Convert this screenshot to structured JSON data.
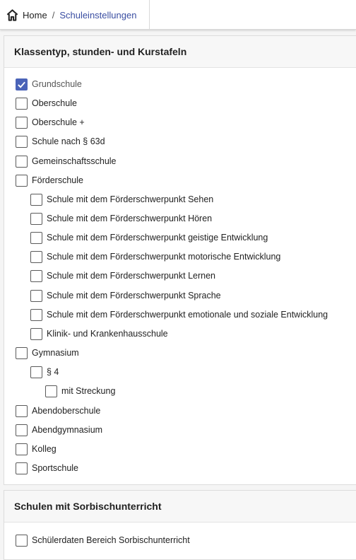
{
  "breadcrumb": {
    "home": "Home",
    "separator": "/",
    "current": "Schuleinstellungen"
  },
  "section1": {
    "title": "Klassentyp, stunden- und Kurstafeln",
    "items": [
      {
        "label": "Grundschule",
        "checked": true
      },
      {
        "label": "Oberschule",
        "checked": false
      },
      {
        "label": "Oberschule +",
        "checked": false
      },
      {
        "label": "Schule nach § 63d",
        "checked": false
      },
      {
        "label": "Gemeinschaftsschule",
        "checked": false
      },
      {
        "label": "Förderschule",
        "checked": false
      },
      {
        "label": "Schule mit dem Förderschwerpunkt Sehen",
        "checked": false
      },
      {
        "label": "Schule mit dem Förderschwerpunkt Hören",
        "checked": false
      },
      {
        "label": "Schule mit dem Förderschwerpunkt geistige Entwicklung",
        "checked": false
      },
      {
        "label": "Schule mit dem Förderschwerpunkt motorische Entwicklung",
        "checked": false
      },
      {
        "label": "Schule mit dem Förderschwerpunkt Lernen",
        "checked": false
      },
      {
        "label": "Schule mit dem Förderschwerpunkt Sprache",
        "checked": false
      },
      {
        "label": "Schule mit dem Förderschwerpunkt emotionale und soziale Entwicklung",
        "checked": false
      },
      {
        "label": "Klinik- und Krankenhausschule",
        "checked": false
      },
      {
        "label": "Gymnasium",
        "checked": false
      },
      {
        "label": "§ 4",
        "checked": false
      },
      {
        "label": "mit Streckung",
        "checked": false
      },
      {
        "label": "Abendoberschule",
        "checked": false
      },
      {
        "label": "Abendgymnasium",
        "checked": false
      },
      {
        "label": "Kolleg",
        "checked": false
      },
      {
        "label": "Sportschule",
        "checked": false
      }
    ]
  },
  "section2": {
    "title": "Schulen mit Sorbischunterricht",
    "items": [
      {
        "label": "Schülerdaten Bereich Sorbischunterricht",
        "checked": false
      }
    ]
  },
  "colors": {
    "accent": "#4a63b8",
    "link": "#3a4ea2"
  }
}
